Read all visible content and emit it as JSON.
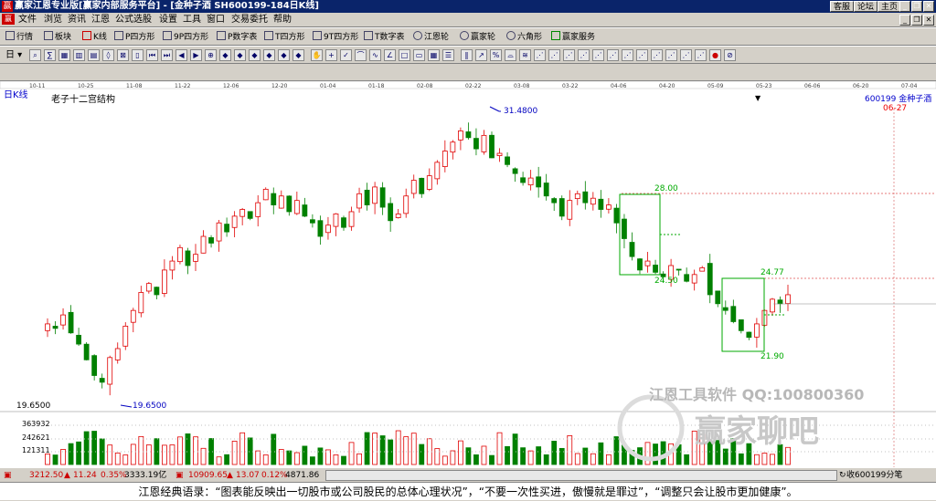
{
  "title": {
    "text": "赢家江恩专业版[赢家内部服务平台] - [金种子酒   SH600199-184日K线]",
    "buttons": [
      "客服",
      "论坛",
      "主页"
    ]
  },
  "menu": [
    "文件",
    "浏览",
    "资讯",
    "江恩",
    "公式选股",
    "设置",
    "工具",
    "窗口",
    "交易委托",
    "帮助"
  ],
  "toolbar1": [
    "行情",
    "板块",
    "K线",
    "P四方形",
    "9P四方形",
    "P数字表",
    "T四方形",
    "9T四方形",
    "T数字表",
    "江恩轮",
    "赢家轮",
    "六角形",
    "赢家服务"
  ],
  "toolbar2_mode": "日",
  "chart": {
    "period_label": "日K线",
    "indicator_label": "老子十二宫结构",
    "code_label": "600199 金种子酒",
    "date_marker": "06-27",
    "dates": [
      "10-11",
      "10-25",
      "11-08",
      "11-22",
      "12-06",
      "12-20",
      "01-04",
      "01-18",
      "02-08",
      "02-22",
      "03-08",
      "03-22",
      "04-06",
      "04-20",
      "05-09",
      "05-23",
      "06-06",
      "06-20",
      "07-04"
    ],
    "annotations": {
      "high": "31.4800",
      "low": "19.6500",
      "level_a": "28.00",
      "level_b": "24.50",
      "level_c": "24.77",
      "level_d": "21.90"
    },
    "y_min_label": "19.6500",
    "vol_labels": [
      "363932",
      "242621",
      "121311"
    ],
    "watermark_text": "江恩工具软件   QQ:100800360",
    "watermark_brand": "赢家聊吧",
    "colors": {
      "up": "#e00000",
      "down": "#008000"
    }
  },
  "chart_data": {
    "type": "candlestick",
    "ylim": [
      19.0,
      32.5
    ],
    "high": 31.48,
    "low": 19.65,
    "close_series": [
      22.5,
      22.3,
      22.9,
      22.1,
      21.6,
      20.9,
      20.2,
      19.9,
      21.0,
      21.4,
      22.4,
      23.1,
      23.9,
      24.3,
      23.8,
      24.9,
      25.3,
      25.9,
      25.1,
      25.6,
      26.4,
      26.1,
      27.0,
      26.6,
      27.3,
      27.6,
      27.2,
      27.9,
      28.5,
      27.8,
      28.2,
      27.5,
      28.0,
      27.3,
      27.0,
      26.4,
      26.9,
      27.4,
      26.8,
      27.5,
      28.3,
      27.8,
      28.6,
      27.7,
      27.1,
      27.4,
      28.2,
      28.9,
      28.3,
      29.1,
      29.7,
      30.2,
      30.6,
      31.1,
      30.8,
      30.3,
      30.9,
      29.9,
      30.1,
      29.6,
      29.2,
      28.8,
      29.0,
      28.6,
      28.2,
      27.9,
      27.3,
      28.0,
      28.3,
      27.9,
      28.1,
      27.6,
      27.8,
      27.0,
      26.3,
      25.5,
      24.9,
      25.3,
      24.8,
      24.6,
      25.1,
      24.9,
      24.4,
      24.7,
      25.0,
      23.8,
      23.4,
      23.1,
      22.6,
      22.2,
      21.9,
      22.5,
      23.1,
      23.6,
      23.4,
      23.8
    ],
    "volume_max": 485242,
    "volume_ticks": [
      121311,
      242621,
      363932
    ]
  },
  "status": {
    "idx1_value": "3212.50",
    "idx1_change": "11.24",
    "idx1_pct": "0.35%",
    "idx1_amount": "3333.19亿",
    "idx2_value": "10909.65",
    "idx2_change": "13.07",
    "idx2_pct": "0.12%",
    "idx2_amount": "4871.86",
    "right_text": "收600199分笔"
  },
  "quote": "江恩经典语录：“图表能反映出一切股市或公司股民的总体心理状况”，“不要一次性买进，傲慢就是罪过”，“调整只会让股市更加健康”。"
}
